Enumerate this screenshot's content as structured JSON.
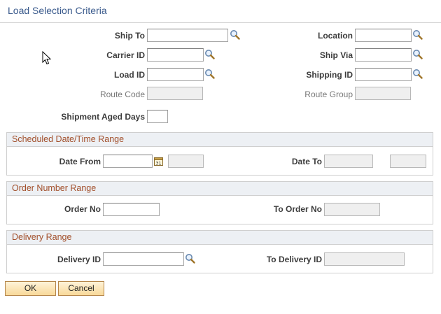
{
  "page": {
    "title": "Load Selection Criteria"
  },
  "criteria": {
    "ship_to": {
      "label": "Ship To",
      "value": ""
    },
    "location": {
      "label": "Location",
      "value": ""
    },
    "carrier_id": {
      "label": "Carrier ID",
      "value": ""
    },
    "ship_via": {
      "label": "Ship Via",
      "value": ""
    },
    "load_id": {
      "label": "Load ID",
      "value": ""
    },
    "shipping_id": {
      "label": "Shipping ID",
      "value": ""
    },
    "route_code": {
      "label": "Route Code",
      "value": ""
    },
    "route_group": {
      "label": "Route Group",
      "value": ""
    },
    "shipment_aged_days": {
      "label": "Shipment Aged Days",
      "value": ""
    }
  },
  "date_range": {
    "title": "Scheduled Date/Time Range",
    "date_from": {
      "label": "Date From",
      "value": "",
      "time_value": ""
    },
    "date_to": {
      "label": "Date To",
      "value": "",
      "time_value": ""
    }
  },
  "order_range": {
    "title": "Order Number Range",
    "order_no": {
      "label": "Order No",
      "value": ""
    },
    "to_order_no": {
      "label": "To Order No",
      "value": ""
    }
  },
  "delivery_range": {
    "title": "Delivery Range",
    "delivery_id": {
      "label": "Delivery ID",
      "value": ""
    },
    "to_delivery_id": {
      "label": "To Delivery ID",
      "value": ""
    }
  },
  "actions": {
    "ok_label": "OK",
    "cancel_label": "Cancel"
  },
  "icons": {
    "lookup": "magnifier-icon",
    "calendar": "calendar-icon"
  },
  "colors": {
    "title": "#3a5a8c",
    "section_title": "#a24f2b",
    "section_bg": "#edf0f4",
    "button_bg": "#f8d999"
  }
}
